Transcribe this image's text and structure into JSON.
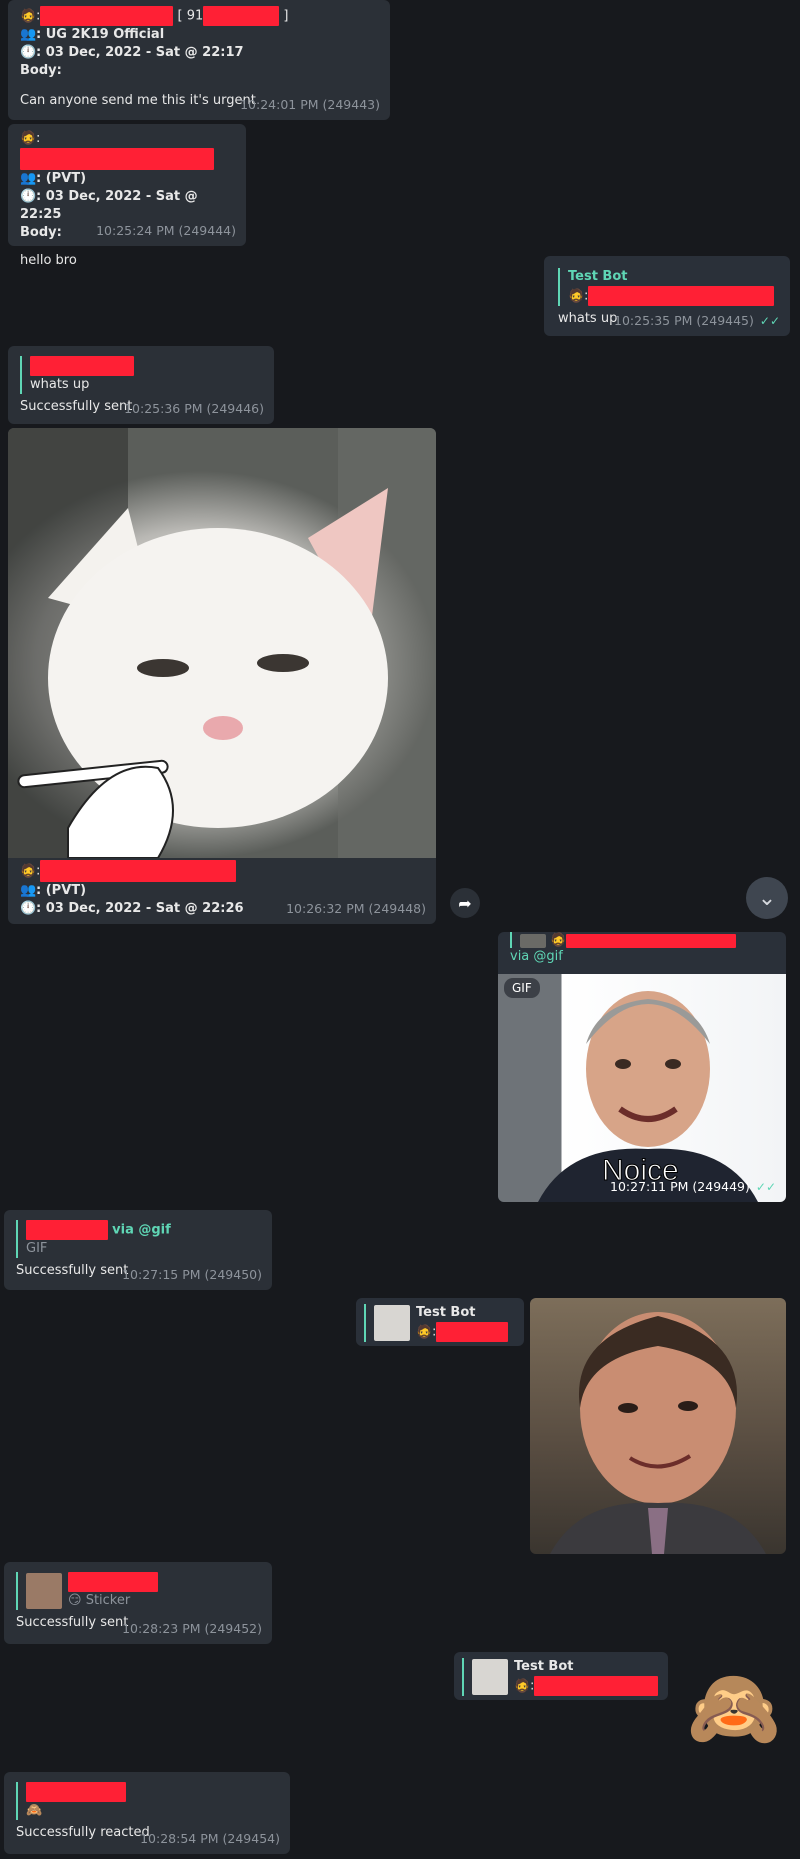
{
  "m1": {
    "sep_open": ":",
    "sep_mid": "[ 91",
    "sep_close": "]",
    "group_label": ": UG 2K19 Official",
    "date_label": ": 03 Dec, 2022 - Sat @ 22:17",
    "body_label": "Body:",
    "text": "Can anyone send me this it's urgent",
    "time": "10:24:01 PM (249443)"
  },
  "m2": {
    "sep": ":",
    "group_label": ": (PVT)",
    "date_label": ": 03 Dec, 2022 - Sat @ 22:25",
    "body_label": "Body:",
    "text": "hello bro",
    "time": "10:25:24 PM (249444)"
  },
  "m3": {
    "reply_name": "Test Bot",
    "sep": ":",
    "text": "whats up",
    "time": "10:25:35 PM (249445)"
  },
  "m4": {
    "reply_text": "whats up",
    "text": "Successfully sent",
    "time": "10:25:36 PM (249446)"
  },
  "m5": {
    "sep": ":",
    "group_label": ": (PVT)",
    "date_label": ": 03 Dec, 2022 - Sat @ 22:26",
    "time": "10:26:32 PM (249448)"
  },
  "m6": {
    "via": "via @gif",
    "badge": "GIF",
    "caption": "Noice",
    "time": "10:27:11 PM (249449)"
  },
  "m7": {
    "via": "via @gif",
    "reply_sub": "GIF",
    "text": "Successfully sent",
    "time": "10:27:15 PM (249450)"
  },
  "m8": {
    "reply_name": "Test Bot",
    "sep": ":"
  },
  "m9": {
    "reply_sub": "Sticker",
    "text": "Successfully sent",
    "time": "10:28:23 PM (249452)"
  },
  "m10": {
    "reply_name": "Test Bot",
    "sep": ":",
    "sticker": "🙈"
  },
  "m11": {
    "reply_emoji": "🙈",
    "text": "Successfully reacted",
    "time": "10:28:54 PM (249454)"
  },
  "icons": {
    "person": "🧔",
    "group": "👥",
    "clock": "🕛",
    "forward": "➦",
    "scroll_down": "⌄",
    "check": "✓✓",
    "emoji_sticker": "😏"
  },
  "colors": {
    "background": "#17191d",
    "bubble": "#2b3037",
    "accent": "#5fd6b5",
    "redaction": "#ff2035"
  }
}
